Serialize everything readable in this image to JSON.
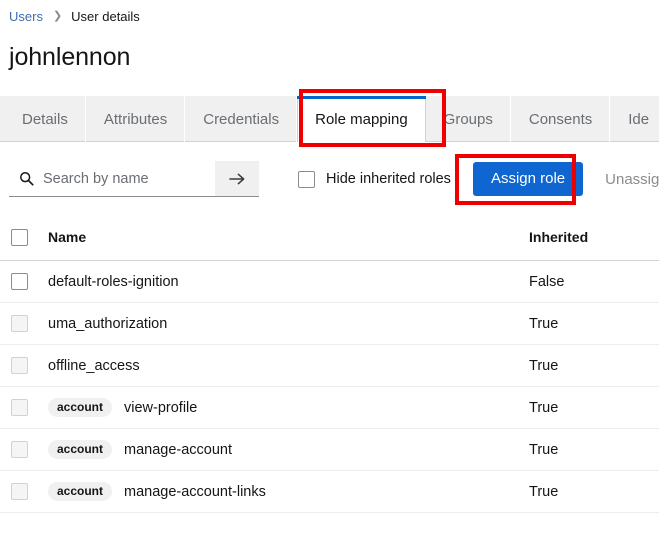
{
  "breadcrumb": {
    "parent_label": "Users",
    "separator": "❯",
    "current_label": "User details"
  },
  "page_title": "johnlennon",
  "tabs": [
    {
      "label": "Details",
      "active": false
    },
    {
      "label": "Attributes",
      "active": false
    },
    {
      "label": "Credentials",
      "active": false
    },
    {
      "label": "Role mapping",
      "active": true
    },
    {
      "label": "Groups",
      "active": false
    },
    {
      "label": "Consents",
      "active": false
    },
    {
      "label": "Ide",
      "active": false
    }
  ],
  "toolbar": {
    "search_placeholder": "Search by name",
    "search_value": "",
    "search_icon": "search-icon",
    "search_submit_icon": "arrow-right-icon",
    "hide_inherited_label": "Hide inherited roles",
    "hide_inherited_checked": false,
    "assign_role_label": "Assign role",
    "unassign_label": "Unassign",
    "unassign_disabled": true
  },
  "table": {
    "select_all_checked": false,
    "columns": {
      "name": "Name",
      "inherited": "Inherited"
    },
    "rows": [
      {
        "badge": "",
        "name": "default-roles-ignition",
        "inherited": "False",
        "checkbox_disabled": false
      },
      {
        "badge": "",
        "name": "uma_authorization",
        "inherited": "True",
        "checkbox_disabled": true
      },
      {
        "badge": "",
        "name": "offline_access",
        "inherited": "True",
        "checkbox_disabled": true
      },
      {
        "badge": "account",
        "name": "view-profile",
        "inherited": "True",
        "checkbox_disabled": true
      },
      {
        "badge": "account",
        "name": "manage-account",
        "inherited": "True",
        "checkbox_disabled": true
      },
      {
        "badge": "account",
        "name": "manage-account-links",
        "inherited": "True",
        "checkbox_disabled": true
      }
    ]
  },
  "annotations": {
    "accent_color": "#ee0000",
    "items": [
      {
        "target": "tab-role-mapping"
      },
      {
        "target": "assign-role-button"
      }
    ]
  },
  "colors": {
    "primary_button": "#0f66d0",
    "link": "#3c6eb4",
    "active_tab_bar": "#06c",
    "annotation": "#ee0000"
  }
}
